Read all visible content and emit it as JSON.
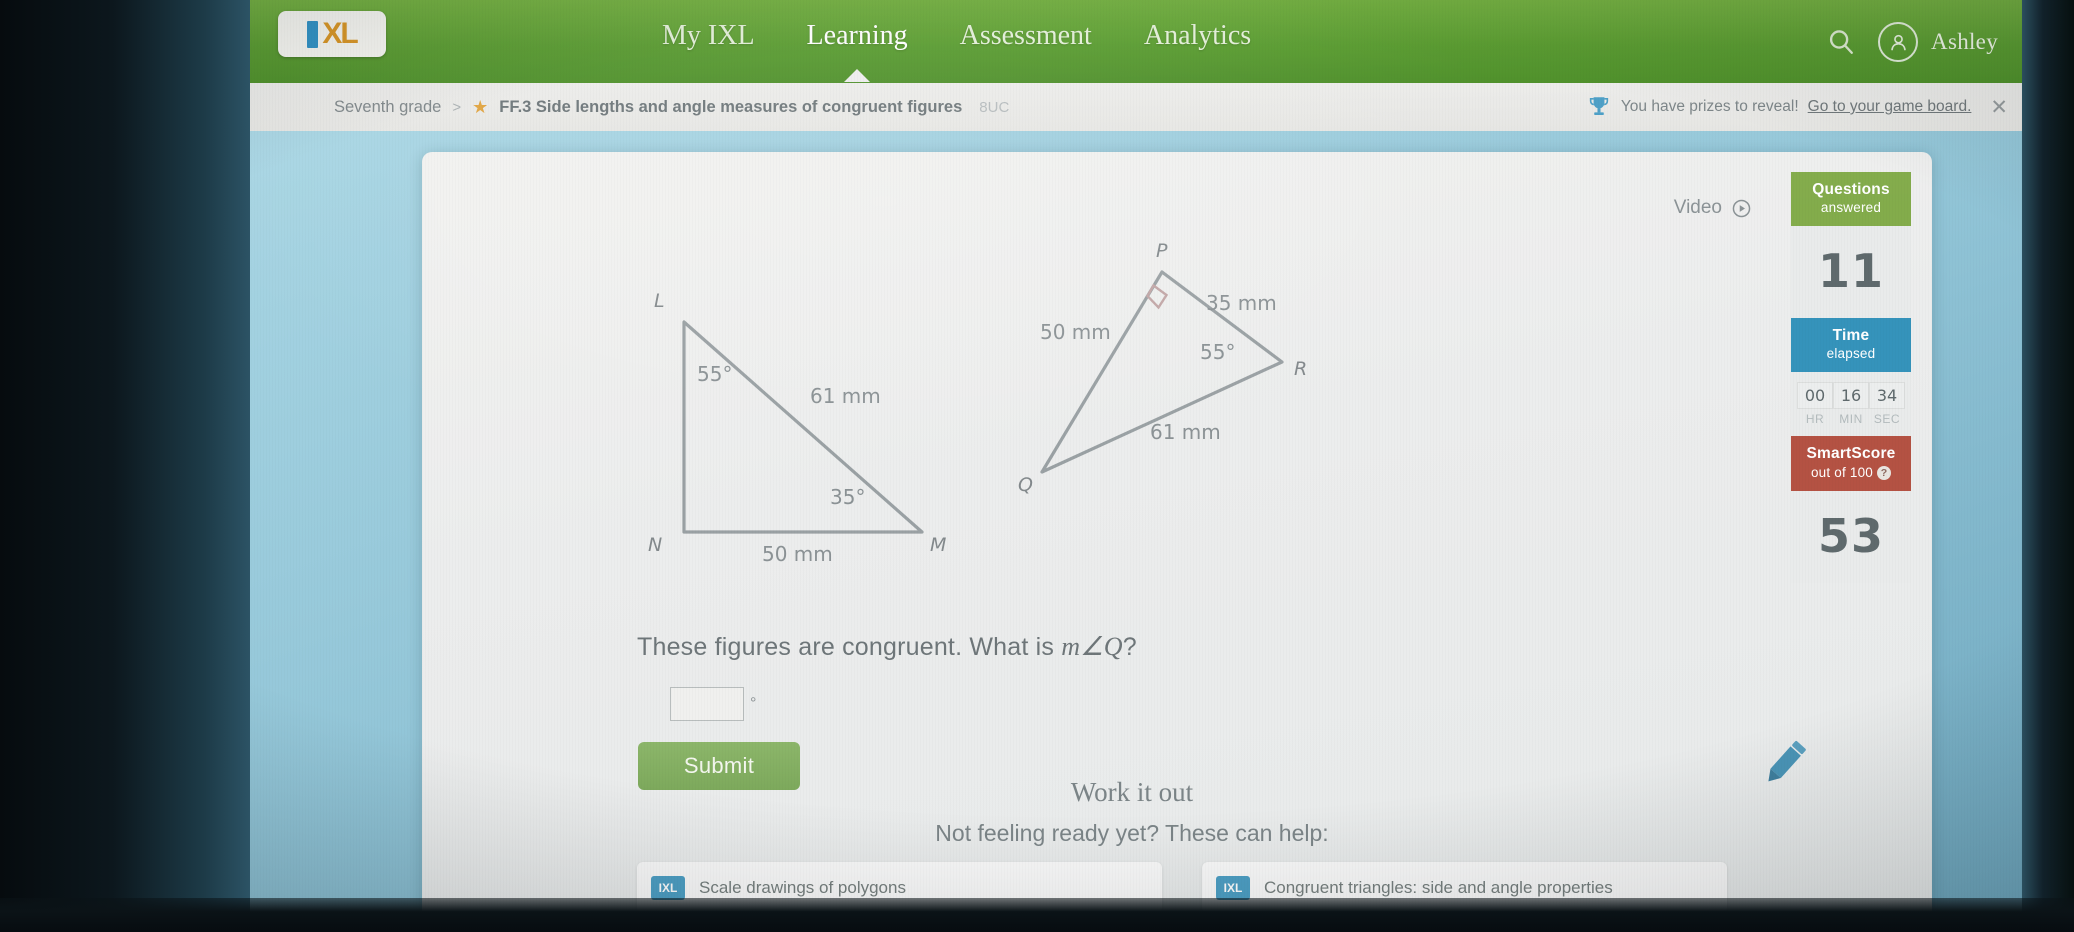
{
  "nav": {
    "logo": {
      "i": "I",
      "xl": "XL",
      "alt": "IXL"
    },
    "items": [
      {
        "label": "My IXL",
        "active": false
      },
      {
        "label": "Learning",
        "active": true
      },
      {
        "label": "Assessment",
        "active": false
      },
      {
        "label": "Analytics",
        "active": false
      }
    ],
    "search_icon": "search-icon",
    "user_icon": "user-avatar-icon",
    "username": "Ashley"
  },
  "breadcrumb": {
    "grade": "Seventh grade",
    "separator": ">",
    "star_icon": "star-icon",
    "skill": "FF.3 Side lengths and angle measures of congruent figures",
    "code": "8UC"
  },
  "prize_banner": {
    "trophy_icon": "trophy-icon",
    "text": "You have prizes to reveal!",
    "link": "Go to your game board.",
    "close_icon": "close-icon"
  },
  "video": {
    "label": "Video",
    "icon": "play-circle-icon"
  },
  "score_panel": {
    "questions": {
      "title_line1": "Questions",
      "title_line2": "answered",
      "value": "11",
      "color": "#83ac4b"
    },
    "time": {
      "title_line1": "Time",
      "title_line2": "elapsed",
      "color": "#3593bb",
      "hr": "00",
      "min": "16",
      "sec": "34",
      "hr_label": "HR",
      "min_label": "MIN",
      "sec_label": "SEC"
    },
    "smartscore": {
      "title": "SmartScore",
      "subtitle": "out of 100",
      "help_icon": "help-icon",
      "value": "53",
      "color": "#b45243"
    }
  },
  "figures": {
    "left_triangle": {
      "name": "triangle-LNM",
      "vertices": {
        "L": "L",
        "N": "N",
        "M": "M"
      },
      "angles": {
        "at_L": "55°",
        "at_M": "35°"
      },
      "sides": {
        "LM": "61 mm",
        "NM": "50 mm"
      }
    },
    "right_triangle": {
      "name": "triangle-PQR",
      "vertices": {
        "P": "P",
        "Q": "Q",
        "R": "R"
      },
      "right_angle_at": "P",
      "angles": {
        "at_R": "55°"
      },
      "sides": {
        "QP": "50 mm",
        "PR": "35 mm",
        "QR": "61 mm"
      }
    }
  },
  "question": {
    "text_before": "These figures are congruent. What is ",
    "math": "m∠Q",
    "text_after": "?",
    "answer_value": "",
    "answer_placeholder": "",
    "degree_symbol": "°"
  },
  "submit_button": "Submit",
  "work_it_out": {
    "heading": "Work it out",
    "subheading": "Not feeling ready yet? These can help:"
  },
  "help_links": [
    {
      "badge": "IXL",
      "text": "Scale drawings of polygons"
    },
    {
      "badge": "IXL",
      "text": "Congruent triangles: side and angle properties"
    }
  ],
  "scratchpad": {
    "icon": "pencil-icon"
  },
  "colors": {
    "nav_green": "#55992b",
    "page_blue": "#93c6d8",
    "card_gray": "#ececea",
    "submit_green": "#7da95c",
    "accent_orange": "#d8931f",
    "accent_blue": "#2b8fc4"
  }
}
